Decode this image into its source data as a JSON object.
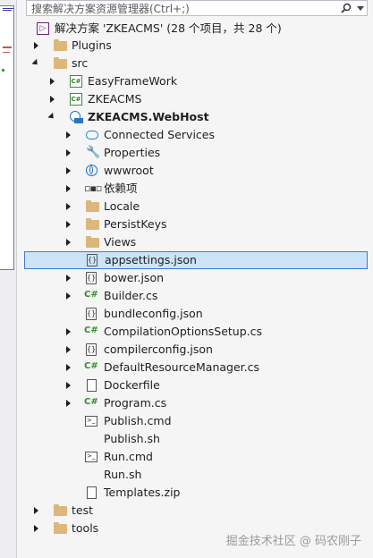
{
  "search": {
    "placeholder": "搜索解决方案资源管理器(Ctrl+;)"
  },
  "tree": {
    "solution": "解决方案 'ZKEACMS' (28 个项目，共 28 个)",
    "items": [
      {
        "label": "Plugins",
        "icon": "folder-icon",
        "arrow": "collapsed"
      },
      {
        "label": "src",
        "icon": "folder-icon",
        "arrow": "expanded"
      },
      {
        "label": "EasyFrameWork",
        "icon": "csharp-project-icon",
        "arrow": "collapsed"
      },
      {
        "label": "ZKEACMS",
        "icon": "csharp-project-icon",
        "arrow": "collapsed"
      },
      {
        "label": "ZKEACMS.WebHost",
        "icon": "web-project-icon",
        "arrow": "expanded"
      },
      {
        "label": "Connected Services",
        "icon": "connected-services-icon",
        "arrow": "collapsed"
      },
      {
        "label": "Properties",
        "icon": "wrench-icon",
        "arrow": "collapsed"
      },
      {
        "label": "wwwroot",
        "icon": "globe-icon",
        "arrow": "collapsed"
      },
      {
        "label": "依赖项",
        "icon": "dependencies-icon",
        "arrow": "collapsed"
      },
      {
        "label": "Locale",
        "icon": "folder-icon",
        "arrow": "collapsed"
      },
      {
        "label": "PersistKeys",
        "icon": "folder-icon",
        "arrow": "collapsed"
      },
      {
        "label": "Views",
        "icon": "folder-icon",
        "arrow": "collapsed"
      },
      {
        "label": "appsettings.json",
        "icon": "json-file-icon",
        "arrow": "none"
      },
      {
        "label": "bower.json",
        "icon": "json-file-icon",
        "arrow": "collapsed"
      },
      {
        "label": "Builder.cs",
        "icon": "csharp-file-icon",
        "arrow": "collapsed"
      },
      {
        "label": "bundleconfig.json",
        "icon": "json-file-icon",
        "arrow": "none"
      },
      {
        "label": "CompilationOptionsSetup.cs",
        "icon": "csharp-file-icon",
        "arrow": "collapsed"
      },
      {
        "label": "compilerconfig.json",
        "icon": "json-file-icon",
        "arrow": "collapsed"
      },
      {
        "label": "DefaultResourceManager.cs",
        "icon": "csharp-file-icon",
        "arrow": "collapsed"
      },
      {
        "label": "Dockerfile",
        "icon": "file-icon",
        "arrow": "collapsed"
      },
      {
        "label": "Program.cs",
        "icon": "csharp-file-icon",
        "arrow": "collapsed"
      },
      {
        "label": "Publish.cmd",
        "icon": "cmd-file-icon",
        "arrow": "none"
      },
      {
        "label": "Publish.sh",
        "icon": "none",
        "arrow": "none"
      },
      {
        "label": "Run.cmd",
        "icon": "cmd-file-icon",
        "arrow": "none"
      },
      {
        "label": "Run.sh",
        "icon": "none",
        "arrow": "none"
      },
      {
        "label": "Templates.zip",
        "icon": "file-icon",
        "arrow": "none"
      },
      {
        "label": "test",
        "icon": "folder-icon",
        "arrow": "collapsed"
      },
      {
        "label": "tools",
        "icon": "folder-icon",
        "arrow": "collapsed"
      }
    ]
  },
  "watermark": "掘金技术社区 @ 码农刚子"
}
